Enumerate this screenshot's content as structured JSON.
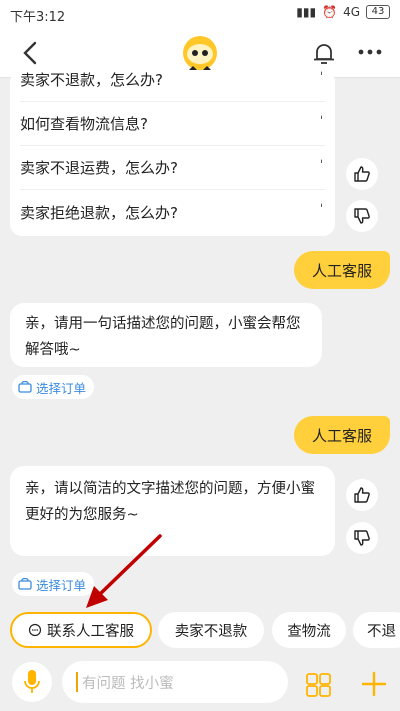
{
  "status_bar": {
    "time": "下午3:12",
    "network": "4G",
    "battery": "43"
  },
  "header": {
    "logo_icon": "bee-mascot-icon",
    "bell_icon": "bell-icon",
    "more_icon": "more-dots-icon"
  },
  "faq": {
    "items": [
      {
        "text": "卖家不退款，怎么办?"
      },
      {
        "text": "如何查看物流信息?"
      },
      {
        "text": "卖家不退运费，怎么办?"
      },
      {
        "text": "卖家拒绝退款，怎么办?"
      }
    ]
  },
  "messages": {
    "user_1": "人工客服",
    "bot_1": "亲，请用一句话描述您的问题，小蜜会帮您解答哦~",
    "select_order_1": "选择订单",
    "user_2": "人工客服",
    "bot_2": "亲，请以简洁的文字描述您的问题，方便小蜜更好的为您服务~",
    "select_order_2": "选择订单"
  },
  "quick_replies": [
    {
      "label": "联系人工客服"
    },
    {
      "label": "卖家不退款"
    },
    {
      "label": "查物流"
    },
    {
      "label": "不退"
    }
  ],
  "input": {
    "placeholder": "有问题 找小蜜"
  },
  "colors": {
    "accent": "#ffcf3c",
    "link": "#3a8be0",
    "arrow": "#c00000"
  }
}
